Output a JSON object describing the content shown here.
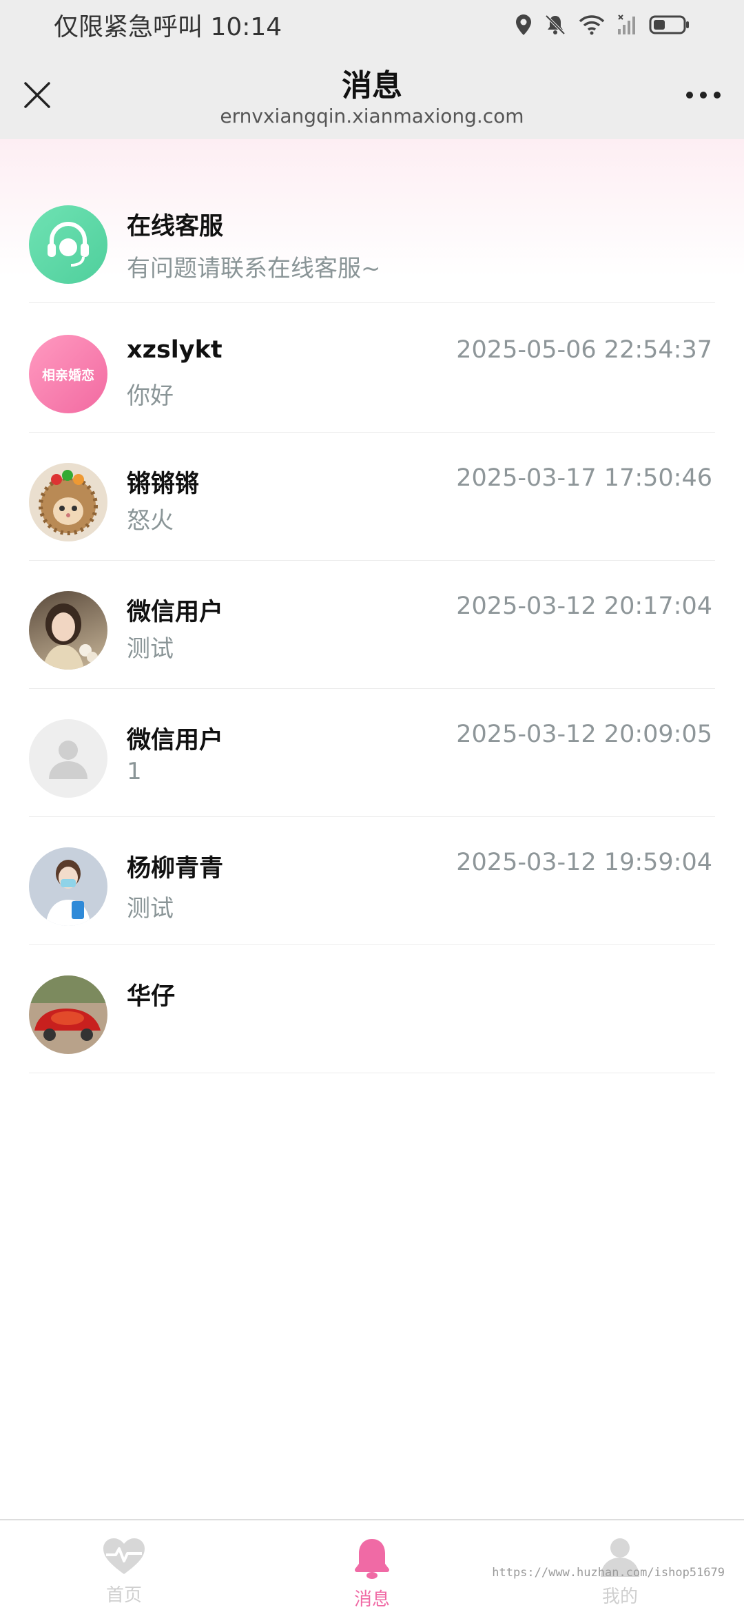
{
  "status_bar": {
    "carrier_text": "仅限紧急呼叫",
    "time": "10:14",
    "icons": [
      "location-icon",
      "mute-bell-icon",
      "wifi-icon",
      "signal-icon",
      "battery-icon"
    ]
  },
  "header": {
    "title": "消息",
    "url": "ernvxiangqin.xianmaxiong.com",
    "close_icon": "close-icon",
    "more_icon": "more-icon"
  },
  "messages": [
    {
      "name": "在线客服",
      "preview": "有问题请联系在线客服~",
      "time": "",
      "avatar": "customer-service-icon"
    },
    {
      "name": "xzslykt",
      "preview": "你好",
      "time": "2025-05-06 22:54:37",
      "avatar": "badge-avatar",
      "avatar_text": "相亲婚恋"
    },
    {
      "name": "锵锵锵",
      "preview": "怒火",
      "time": "2025-03-17 17:50:46",
      "avatar": "cartoon-avatar"
    },
    {
      "name": "微信用户",
      "preview": "测试",
      "time": "2025-03-12 20:17:04",
      "avatar": "photo-avatar"
    },
    {
      "name": "微信用户",
      "preview": "1",
      "time": "2025-03-12 20:09:05",
      "avatar": "default-avatar"
    },
    {
      "name": "杨柳青青",
      "preview": "测试",
      "time": "2025-03-12 19:59:04",
      "avatar": "nurse-avatar"
    },
    {
      "name": "华仔",
      "preview": "",
      "time": "",
      "avatar": "car-avatar"
    }
  ],
  "bottom_nav": [
    {
      "label": "首页",
      "icon": "heart-pulse-icon",
      "active": false
    },
    {
      "label": "消息",
      "icon": "bell-icon",
      "active": true
    },
    {
      "label": "我的",
      "icon": "user-icon",
      "active": false
    }
  ],
  "watermark": "https://www.huzhan.com/ishop51679",
  "colors": {
    "accent": "#f06aa5",
    "header_bg": "#ededed",
    "service_green": "#5ed9a6",
    "muted_text": "#8e9699"
  }
}
